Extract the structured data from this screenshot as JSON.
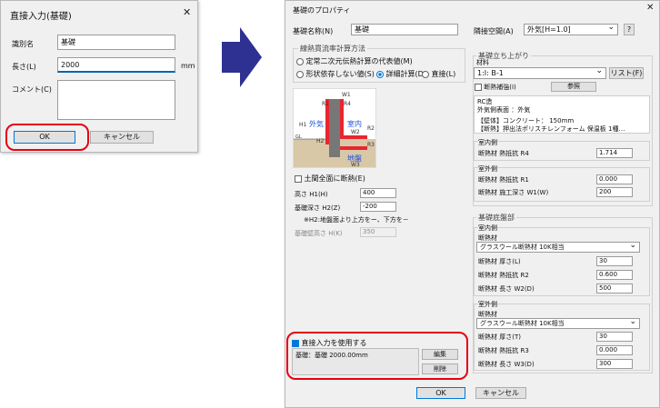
{
  "left_dialog": {
    "title": "直接入力(基礎)",
    "id_label": "識別名",
    "id_value": "基礎",
    "length_label": "長さ(L)",
    "length_value": "2000",
    "length_unit": "mm",
    "comment_label": "コメント(C)",
    "comment_value": "",
    "ok_label": "OK",
    "cancel_label": "キャンセル"
  },
  "arrow_color": "#2e3192",
  "highlight_color": "#e60012",
  "right_dialog": {
    "title": "基礎のプロパティ",
    "name_label": "基礎名称(N)",
    "name_value": "基礎",
    "space_label": "隣接空間(A)",
    "space_value": "外気[H=1.0]",
    "help_label": "?",
    "calc_group": {
      "title": "線熱貫流率計算方法",
      "opt1": "定常二次元伝熱計算の代表値(M)",
      "opt2": "形状依存しない値(S)",
      "opt3": "詳細計算(D)",
      "opt4": "直接(L)"
    },
    "diagram": {
      "w1": "W1",
      "r1": "R1",
      "r4": "R4",
      "h1": "H1",
      "r2": "R2",
      "h2": "H2",
      "w2": "W2",
      "r3": "R3",
      "gl": "GL",
      "w3": "W3",
      "outside": "外気",
      "inside": "室内",
      "ground": "地盤"
    },
    "floor_insul_label": "土間全面に断熱(E)",
    "h1_label": "高さ H1(H)",
    "h1_value": "400",
    "h2_label": "基礎深さ H2(Z)",
    "h2_value": "-200",
    "note": "※H2:地盤面より上方をー、下方を－",
    "wall_height_label": "基礎壁高さ H(K)",
    "wall_height_value": "350",
    "direct_check_label": "直接入力を使用する",
    "direct_summary": "基礎：基礎 2000.00mm",
    "edit_label": "編集",
    "delete_label": "削除",
    "rise": {
      "title": "基礎立ち上がり",
      "material_label": "材料",
      "material_value": "1:I: B-1",
      "list_label": "リスト(F)",
      "insul_check_label": "断熱補強(I)",
      "ref_label": "参照",
      "desc1": "RC造",
      "desc2": "外気側表面 ：外気",
      "desc3": "【壁体】コンクリート：        150mm",
      "desc4": "【断熱】押出法ポリスチレンフォーム 保温板 1種…",
      "indoor_title": "室内側",
      "r4_label": "断熱材 熱抵抗 R4",
      "r4_value": "1.714",
      "outdoor_title": "室外側",
      "r1_label": "断熱材 熱抵抗 R1",
      "r1_value": "0.000",
      "w1_label": "断熱材 施工深さ W1(W)",
      "w1_value": "200"
    },
    "bottom": {
      "title": "基礎底盤部",
      "indoor_title": "室内側",
      "ins_title": "断熱材",
      "ins_value": "グラスウール断熱材 10K相当",
      "thick_label": "断熱材 厚さ(L)",
      "thick_value": "30",
      "r2_label": "断熱材 熱抵抗 R2",
      "r2_value": "0.600",
      "len_label": "断熱材 長さ W2(D)",
      "len_value": "500",
      "outdoor_title": "室外側",
      "ins2_title": "断熱材",
      "ins2_value": "グラスウール断熱材 10K相当",
      "thick2_label": "断熱材 厚さ(T)",
      "thick2_value": "30",
      "r3_label": "断熱材 熱抵抗 R3",
      "r3_value": "0.000",
      "len2_label": "断熱材 長さ W3(D)",
      "len2_value": "300"
    },
    "ok_label": "OK",
    "cancel_label": "キャンセル"
  }
}
